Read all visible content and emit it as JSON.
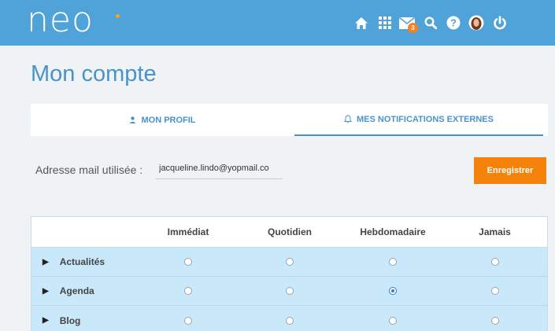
{
  "app": {
    "logo": "neo"
  },
  "topbar": {
    "icons": [
      "home-icon",
      "apps-grid-icon",
      "mail-icon",
      "search-icon",
      "help-icon",
      "avatar",
      "power-icon"
    ],
    "mail_badge": "3"
  },
  "page": {
    "title": "Mon compte"
  },
  "tabs": [
    {
      "label": "MON PROFIL",
      "icon": "person-icon",
      "active": false
    },
    {
      "label": "MES NOTIFICATIONS EXTERNES",
      "icon": "bell-icon",
      "active": true
    }
  ],
  "mail": {
    "label": "Adresse mail utilisée :",
    "value": "jacqueline.lindo@yopmail.co"
  },
  "save_button": "Enregistrer",
  "table": {
    "headers": [
      "",
      "Immédiat",
      "Quotidien",
      "Hebdomadaire",
      "Jamais"
    ],
    "rows": [
      {
        "name": "Actualités",
        "selected": null
      },
      {
        "name": "Agenda",
        "selected": "Hebdomadaire"
      },
      {
        "name": "Blog",
        "selected": null
      }
    ]
  },
  "colors": {
    "topbar": "#4fa3d9",
    "accent": "#4a93c9",
    "button": "#f5820b",
    "row": "#c9e9fa"
  }
}
